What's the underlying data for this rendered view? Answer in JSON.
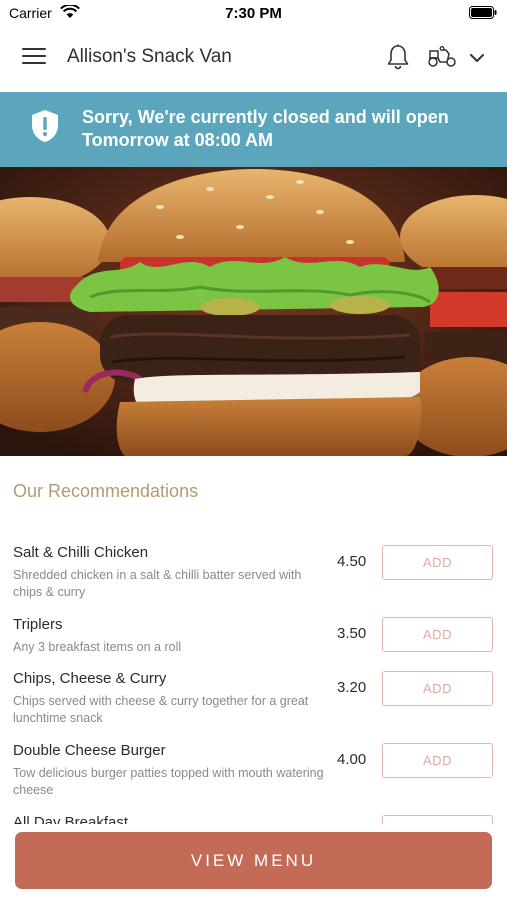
{
  "status_bar": {
    "carrier": "Carrier",
    "time": "7:30 PM"
  },
  "header": {
    "title": "Allison's Snack Van"
  },
  "banner": {
    "line1": "Sorry, We're currently closed and will open",
    "line2": "Tomorrow at 08:00 AM"
  },
  "recommendations": {
    "title": "Our Recommendations",
    "items": [
      {
        "name": "Salt & Chilli Chicken",
        "desc": "Shredded chicken in a salt & chilli batter served with chips & curry",
        "price": "4.50",
        "add_label": "ADD"
      },
      {
        "name": "Triplers",
        "desc": "Any 3 breakfast items on a roll",
        "price": "3.50",
        "add_label": "ADD"
      },
      {
        "name": "Chips, Cheese & Curry",
        "desc": "Chips served with cheese & curry together for a great lunchtime snack",
        "price": "3.20",
        "add_label": "ADD"
      },
      {
        "name": "Double Cheese Burger",
        "desc": "Tow delicious burger patties topped with mouth watering cheese",
        "price": "4.00",
        "add_label": "ADD"
      },
      {
        "name": "All Day Breakfast",
        "desc": "",
        "price": "",
        "add_label": ""
      }
    ]
  },
  "view_menu_label": "VIEW MENU",
  "colors": {
    "banner": "#5ba6bc",
    "accent": "#c36b57",
    "section_title": "#b49a72"
  }
}
